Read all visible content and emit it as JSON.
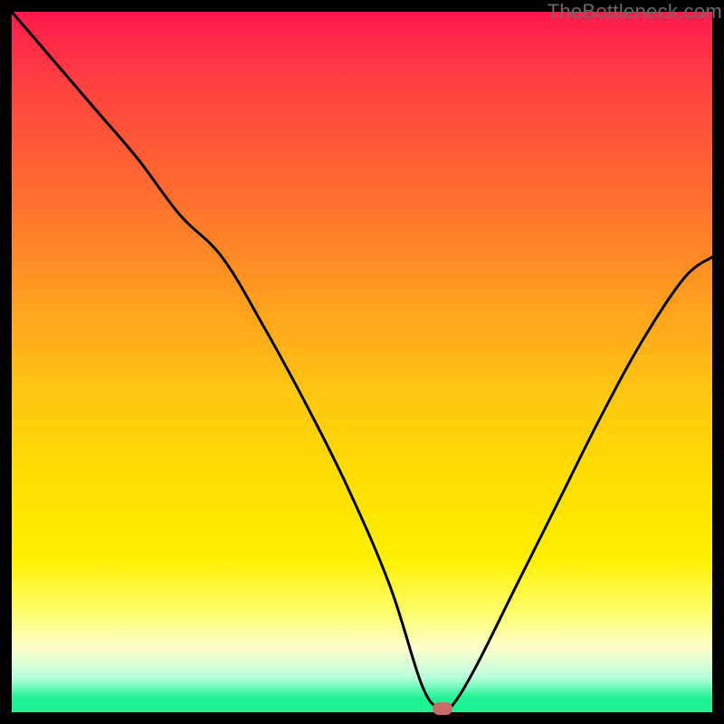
{
  "watermark": "TheBottleneck.com",
  "colors": {
    "curve_stroke": "#000000",
    "marker_fill": "#c76b6b"
  },
  "chart_data": {
    "type": "line",
    "title": "",
    "xlabel": "",
    "ylabel": "",
    "xlim": [
      0,
      100
    ],
    "ylim": [
      0,
      100
    ],
    "grid": false,
    "legend": false,
    "series": [
      {
        "name": "bottleneck-curve",
        "x": [
          0,
          6,
          12,
          18,
          24,
          30,
          36,
          42,
          48,
          54,
          58.5,
          61,
          62.5,
          66,
          72,
          78,
          84,
          90,
          96,
          100
        ],
        "values": [
          100,
          93,
          86,
          79,
          71,
          65,
          55,
          44,
          32,
          18,
          4,
          0.5,
          0.5,
          6,
          18,
          30,
          42,
          53,
          62,
          65
        ]
      }
    ],
    "marker": {
      "x": 61.5,
      "y": 0.5
    },
    "annotations": []
  }
}
